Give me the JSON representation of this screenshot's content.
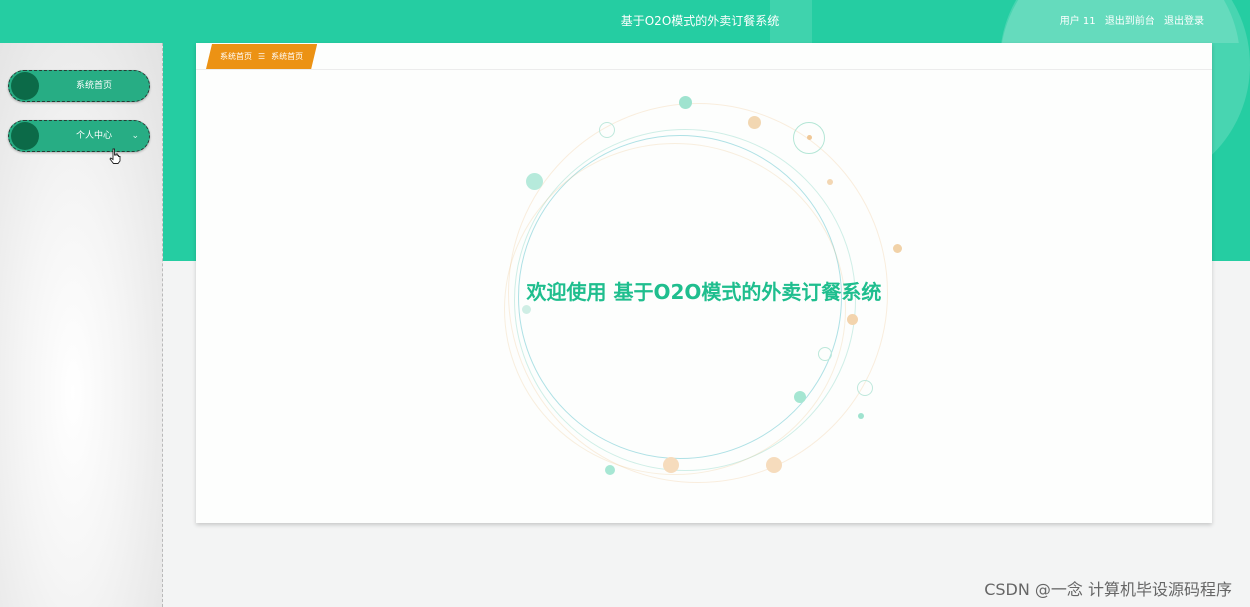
{
  "header": {
    "title": "基于O2O模式的外卖订餐系统",
    "user_label": "用户 11",
    "back_to_front_label": "退出到前台",
    "logout_label": "退出登录"
  },
  "sidebar": {
    "items": [
      {
        "label": "系统首页"
      },
      {
        "label": "个人中心",
        "chevron": "⌄"
      }
    ]
  },
  "breadcrumb": {
    "home": "系统首页",
    "separator": "☰",
    "current": "系统首页"
  },
  "main": {
    "welcome_text": "欢迎使用 基于O2O模式的外卖订餐系统"
  },
  "watermark": "CSDN @一念 计算机毕设源码程序",
  "colors": {
    "primary": "#25cda2",
    "sidebar_button": "#27ad84",
    "knob": "#0c6a48",
    "breadcrumb": "#ec9214",
    "welcome_text": "#1fbe8e"
  }
}
